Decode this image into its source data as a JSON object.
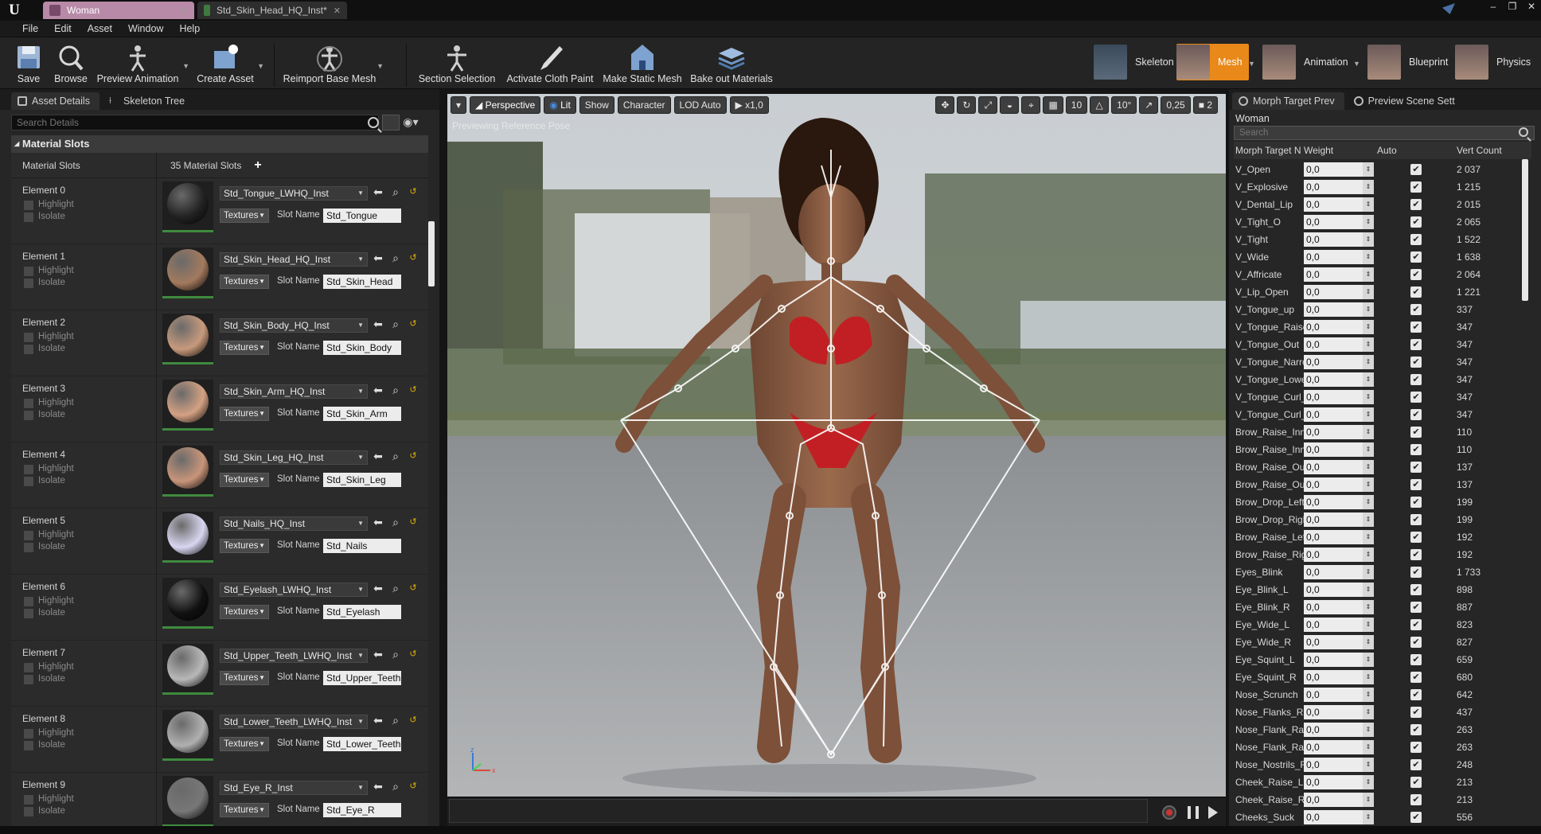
{
  "title_tabs": [
    {
      "label": "Woman"
    },
    {
      "label": "Std_Skin_Head_HQ_Inst*"
    }
  ],
  "menu": [
    "File",
    "Edit",
    "Asset",
    "Window",
    "Help"
  ],
  "toolbar": {
    "buttons": [
      "Save",
      "Browse",
      "Preview Animation",
      "Create Asset",
      "Reimport Base Mesh",
      "Section Selection",
      "Activate Cloth Paint",
      "Make Static Mesh",
      "Bake out Materials"
    ],
    "modes": [
      "Skeleton",
      "Mesh",
      "Animation",
      "Blueprint",
      "Physics"
    ]
  },
  "left": {
    "tabs": [
      "Asset Details",
      "Skeleton Tree"
    ],
    "search_placeholder": "Search Details",
    "section": "Material Slots",
    "slots_label": "Material Slots",
    "slots_count": "35 Material Slots",
    "highlight": "Highlight",
    "isolate": "Isolate",
    "textures": "Textures",
    "slot_name_label": "Slot Name",
    "elements": [
      {
        "label": "Element 0",
        "material": "Std_Tongue_LWHQ_Inst",
        "slot": "Std_Tongue",
        "ball": "#222222"
      },
      {
        "label": "Element 1",
        "material": "Std_Skin_Head_HQ_Inst",
        "slot": "Std_Skin_Head",
        "ball": "#a37a5e"
      },
      {
        "label": "Element 2",
        "material": "Std_Skin_Body_HQ_Inst",
        "slot": "Std_Skin_Body",
        "ball": "#c79a7c"
      },
      {
        "label": "Element 3",
        "material": "Std_Skin_Arm_HQ_Inst",
        "slot": "Std_Skin_Arm",
        "ball": "#d4a183"
      },
      {
        "label": "Element 4",
        "material": "Std_Skin_Leg_HQ_Inst",
        "slot": "Std_Skin_Leg",
        "ball": "#c8957a"
      },
      {
        "label": "Element 5",
        "material": "Std_Nails_HQ_Inst",
        "slot": "Std_Nails",
        "ball": "#d8d6f0"
      },
      {
        "label": "Element 6",
        "material": "Std_Eyelash_LWHQ_Inst",
        "slot": "Std_Eyelash",
        "ball": "#111111"
      },
      {
        "label": "Element 7",
        "material": "Std_Upper_Teeth_LWHQ_Inst",
        "slot": "Std_Upper_Teeth",
        "ball": "#b8b8b8"
      },
      {
        "label": "Element 8",
        "material": "Std_Lower_Teeth_LWHQ_Inst",
        "slot": "Std_Lower_Teeth",
        "ball": "#b0b0b0"
      },
      {
        "label": "Element 9",
        "material": "Std_Eye_R_Inst",
        "slot": "Std_Eye_R",
        "ball": "#777777"
      }
    ]
  },
  "viewport": {
    "perspective": "Perspective",
    "lit": "Lit",
    "show": "Show",
    "character": "Character",
    "lod": "LOD Auto",
    "speed": "x1,0",
    "grid_size": "10",
    "angle": "10°",
    "scale": "0,25",
    "cam_speed": "2",
    "preview_text": "Previewing Reference Pose"
  },
  "right": {
    "tabs": [
      "Morph Target Prev",
      "Preview Scene Sett"
    ],
    "title": "Woman",
    "search_placeholder": "Search",
    "columns": [
      "Morph Target N",
      "Weight",
      "Auto",
      "Vert Count"
    ],
    "rows": [
      {
        "name": "V_Open",
        "w": "0,0",
        "vc": "2 037"
      },
      {
        "name": "V_Explosive",
        "w": "0,0",
        "vc": "1 215"
      },
      {
        "name": "V_Dental_Lip",
        "w": "0,0",
        "vc": "2 015"
      },
      {
        "name": "V_Tight_O",
        "w": "0,0",
        "vc": "2 065"
      },
      {
        "name": "V_Tight",
        "w": "0,0",
        "vc": "1 522"
      },
      {
        "name": "V_Wide",
        "w": "0,0",
        "vc": "1 638"
      },
      {
        "name": "V_Affricate",
        "w": "0,0",
        "vc": "2 064"
      },
      {
        "name": "V_Lip_Open",
        "w": "0,0",
        "vc": "1 221"
      },
      {
        "name": "V_Tongue_up",
        "w": "0,0",
        "vc": "337"
      },
      {
        "name": "V_Tongue_Raise",
        "w": "0,0",
        "vc": "347"
      },
      {
        "name": "V_Tongue_Out",
        "w": "0,0",
        "vc": "347"
      },
      {
        "name": "V_Tongue_Narro",
        "w": "0,0",
        "vc": "347"
      },
      {
        "name": "V_Tongue_Lowe",
        "w": "0,0",
        "vc": "347"
      },
      {
        "name": "V_Tongue_Curl_",
        "w": "0,0",
        "vc": "347"
      },
      {
        "name": "V_Tongue_Curl_",
        "w": "0,0",
        "vc": "347"
      },
      {
        "name": "Brow_Raise_Inne",
        "w": "0,0",
        "vc": "110"
      },
      {
        "name": "Brow_Raise_Inne",
        "w": "0,0",
        "vc": "110"
      },
      {
        "name": "Brow_Raise_Out",
        "w": "0,0",
        "vc": "137"
      },
      {
        "name": "Brow_Raise_Out",
        "w": "0,0",
        "vc": "137"
      },
      {
        "name": "Brow_Drop_Left",
        "w": "0,0",
        "vc": "199"
      },
      {
        "name": "Brow_Drop_Righ",
        "w": "0,0",
        "vc": "199"
      },
      {
        "name": "Brow_Raise_Left",
        "w": "0,0",
        "vc": "192"
      },
      {
        "name": "Brow_Raise_Rig",
        "w": "0,0",
        "vc": "192"
      },
      {
        "name": "Eyes_Blink",
        "w": "0,0",
        "vc": "1 733"
      },
      {
        "name": "Eye_Blink_L",
        "w": "0,0",
        "vc": "898"
      },
      {
        "name": "Eye_Blink_R",
        "w": "0,0",
        "vc": "887"
      },
      {
        "name": "Eye_Wide_L",
        "w": "0,0",
        "vc": "823"
      },
      {
        "name": "Eye_Wide_R",
        "w": "0,0",
        "vc": "827"
      },
      {
        "name": "Eye_Squint_L",
        "w": "0,0",
        "vc": "659"
      },
      {
        "name": "Eye_Squint_R",
        "w": "0,0",
        "vc": "680"
      },
      {
        "name": "Nose_Scrunch",
        "w": "0,0",
        "vc": "642"
      },
      {
        "name": "Nose_Flanks_Ra",
        "w": "0,0",
        "vc": "437"
      },
      {
        "name": "Nose_Flank_Rais",
        "w": "0,0",
        "vc": "263"
      },
      {
        "name": "Nose_Flank_Rais",
        "w": "0,0",
        "vc": "263"
      },
      {
        "name": "Nose_Nostrils_Fl",
        "w": "0,0",
        "vc": "248"
      },
      {
        "name": "Cheek_Raise_L",
        "w": "0,0",
        "vc": "213"
      },
      {
        "name": "Cheek_Raise_R",
        "w": "0,0",
        "vc": "213"
      },
      {
        "name": "Cheeks_Suck",
        "w": "0,0",
        "vc": "556"
      }
    ]
  }
}
